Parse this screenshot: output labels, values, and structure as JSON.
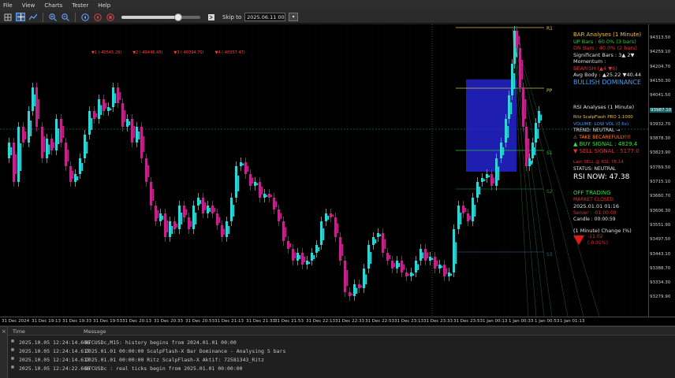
{
  "menu": [
    "File",
    "View",
    "Charts",
    "Tester",
    "Help"
  ],
  "toolbar": {
    "icons": [
      "grid-icon",
      "crosshair-icon",
      "line-chart-icon",
      "zoom-in-icon",
      "zoom-out-icon",
      "step-back-icon",
      "play-icon",
      "stop-icon"
    ],
    "slider_value": 0.72,
    "skip_to_label": "Skip to",
    "date_value": "2025.06.11 00:00",
    "calendar_icon": "calendar-icon"
  },
  "chart": {
    "top_levels": [
      "▼1 (-40545.28)",
      "▼2 (-40446.45)",
      "▼3 (-40394.70)",
      "▼4 (-40357.47)"
    ],
    "level_labels": [
      "R1",
      "PP",
      "S1",
      "S2",
      "S3"
    ],
    "price_labels": [
      "94313.50",
      "94259.10",
      "94204.70",
      "94150.30",
      "94041.50",
      "93987.10",
      "93932.70",
      "93878.30",
      "93823.90",
      "93769.50",
      "93715.10",
      "93660.70",
      "93606.30",
      "93551.90",
      "93497.50",
      "93443.10",
      "93388.70",
      "93334.30",
      "93279.90"
    ],
    "price_highlight": "93987.10",
    "time_labels": [
      "31 Dec 2024",
      "31 Dec 19:13",
      "31 Dec 19:33",
      "31 Dec 19:53",
      "31 Dec 20:13",
      "31 Dec 20:33",
      "31 Dec 20:53",
      "31 Dec 21:13",
      "31 Dec 21:33",
      "31 Dec 21:53",
      "31 Dec 22:13",
      "31 Dec 22:33",
      "31 Dec 22:53",
      "31 Dec 23:13",
      "31 Dec 23:33",
      "31 Dec 23:53",
      "1 Jan 00:13",
      "1 Jan 00:33",
      "1 Jan 00:53",
      "1 Jan 01:13"
    ]
  },
  "panel": {
    "bar_title": "BAR Analyses (1 Minute)",
    "up_bars": "UP Bars : 60.0% (3 bars)",
    "dn_bars": "DN Bars : 40.0% (2 bars)",
    "significant": "Significant Bars : 3▲ 2▼",
    "momentum": "Momentum :",
    "momentum_val": "BEARISH (▲4 ▼6)",
    "avg_body": "Avg Body : ▲25.22 ▼40.44",
    "dominance": "BULLISH DOMINANCE",
    "rsi_title": "RSI Analyses (1 Minute)",
    "ritz": "Ritz ScalpFlash PRO 1:1000",
    "volume": "VOLUME: LOW VOL (0.6x)",
    "trend": "TREND: NEUTRAL →",
    "take": "⚠ TAKE BECAREFULLY!!!",
    "buy": "▲ BUY SIGNAL : 4829.4",
    "sell": "▼ SELL SIGNAL : 5177.0",
    "last_sell": "Last SELL @ RSI: 78.14",
    "status": "STATUS: NEUTRAL",
    "rsi_now": "RSI NOW: 47.38",
    "off_trading": "OFF TRADING",
    "market_closed": "MARKET CLOSED",
    "date": "2025.01.01 01:16",
    "server": "Server : -01:00:00",
    "candle": "Candle : 00:00:59",
    "change_title": "(1 Minute) Change (%)",
    "change_val": "-11.02",
    "change_pct": "(-0.01%)"
  },
  "colors": {
    "bull": "#2fd6d6",
    "bear": "#c2248a",
    "box": "#2323d0",
    "gold": "#d9c23a"
  },
  "terminal": {
    "headers": [
      "Time",
      "Message"
    ],
    "rows": [
      {
        "time": "2025.10.05 12:24:14.606",
        "msg": "BTCUSDc,M15: history begins from 2024.01.01 00:00"
      },
      {
        "time": "2025.10.05 12:24:14.617",
        "msg": "2025.01.01 00:00:00   ScalpFlash-X Bar Dominance - Analysing 5 bars"
      },
      {
        "time": "2025.10.05 12:24:14.617",
        "msg": "2025.01.01 00:00:00   Ritz ScalpFlash-X Aktif:         72581343_Ritz"
      },
      {
        "time": "2025.10.05 12:24:22.666",
        "msg": "BTCUSDc : real ticks begin from 2025.01.01 00:00:00"
      }
    ]
  }
}
